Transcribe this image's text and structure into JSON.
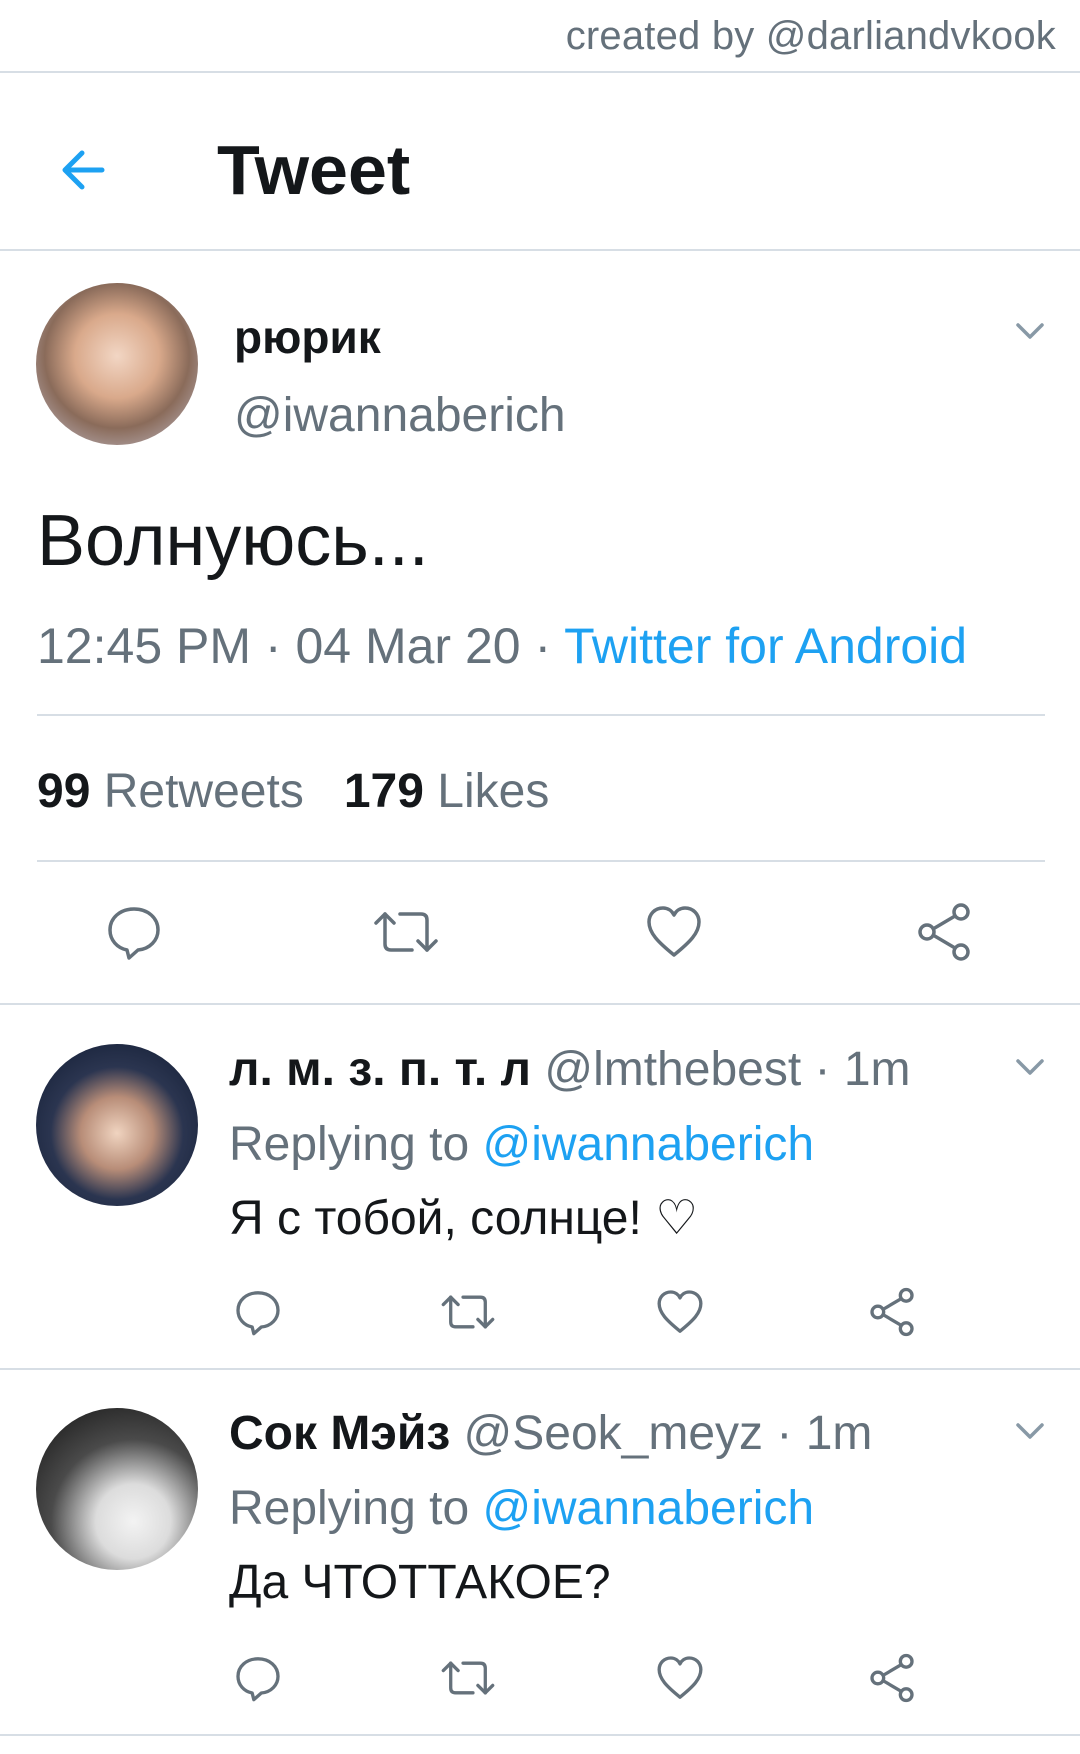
{
  "watermark": "created by @darliandvkook",
  "header": {
    "title": "Tweet",
    "back_icon": "arrow-left-icon"
  },
  "colors": {
    "accent": "#1da1f2",
    "secondary_text": "#65717b",
    "primary_text": "#14171a",
    "divider": "#d7dee5"
  },
  "tweet": {
    "author_name": "рюрик",
    "author_handle": "@iwannaberich",
    "text": "Волнуюсь...",
    "time": "12:45 PM",
    "date": "04 Mar 20",
    "sep": " · ",
    "source": "Twitter for Android",
    "retweets_count": "99",
    "retweets_label": "Retweets",
    "likes_count": "179",
    "likes_label": "Likes"
  },
  "replies": [
    {
      "name": "л. м. з. п. т. л",
      "handle": "@lmthebest",
      "time": "1m",
      "replying_prefix": "Replying to",
      "replying_to": "@iwannaberich",
      "text": "Я с тобой, солнце! ♡"
    },
    {
      "name": "Сок Мэйз",
      "handle": "@Seok_meyz",
      "time": "1m",
      "replying_prefix": "Replying to",
      "replying_to": "@iwannaberich",
      "text": "Да ЧТОТТАКОЕ?"
    }
  ],
  "actions": [
    "reply-icon",
    "retweet-icon",
    "like-icon",
    "share-icon"
  ]
}
